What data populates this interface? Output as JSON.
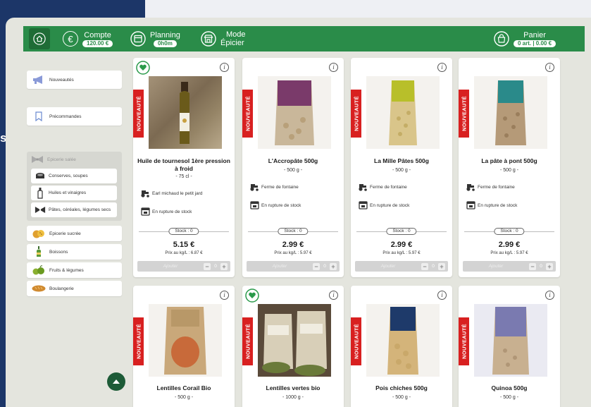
{
  "background_letter": "s",
  "topbar": {
    "compte_label": "Compte",
    "compte_value": "120.00 €",
    "planning_label": "Planning",
    "planning_value": "0h0m",
    "mode_line1": "Mode",
    "mode_line2": "Épicier",
    "panier_label": "Panier",
    "panier_value": "0 art. | 0.00 €"
  },
  "sidebar": {
    "nouveautes": "Nouveautés",
    "precommandes": "Précommandes",
    "epicerie_salee": "Epicerie salée",
    "subitems": [
      "Conserves, soupes",
      "Huiles et vinaigres",
      "Pâtes, céréales, légumes secs"
    ],
    "categories": [
      "Epicerie sucrée",
      "Boissons",
      "Fruits & légumes",
      "Boulangerie"
    ]
  },
  "common": {
    "badge": "NOUVEAUTÉ",
    "rupture": "En rupture de stock",
    "add_label": "Ajouter",
    "qty": "0",
    "info": "i"
  },
  "products": [
    {
      "name": "Huile de tournesol 1ère pression à froid",
      "qty": "- 75 cl -",
      "producer": "Earl michaud le petit jard",
      "stock": "Stock : 0",
      "price": "5.15 €",
      "price_per_kg": "Prix au kg/L : 6.87 €",
      "bio": true,
      "img_color": "#8a7a62"
    },
    {
      "name": "L'Accropâte 500g",
      "qty": "- 500 g -",
      "producer": "Ferme de fontaine",
      "stock": "Stock : 0",
      "price": "2.99 €",
      "price_per_kg": "Prix au kg/L : 5.97 €",
      "bio": false,
      "img_color": "#7a3a6a"
    },
    {
      "name": "La Mille Pâtes 500g",
      "qty": "- 500 g -",
      "producer": "Ferme de fontaine",
      "stock": "Stock : 0",
      "price": "2.99 €",
      "price_per_kg": "Prix au kg/L : 5.97 €",
      "bio": false,
      "img_color": "#b8bf2a"
    },
    {
      "name": "La pâte à pont 500g",
      "qty": "- 500 g -",
      "producer": "Ferme de fontaine",
      "stock": "Stock : 0",
      "price": "2.99 €",
      "price_per_kg": "Prix au kg/L : 5.97 €",
      "bio": false,
      "img_color": "#2a8a8a"
    },
    {
      "name": "Lentilles Corail Bio",
      "qty": "- 500 g -",
      "bio": false,
      "img_color": "#c06a3a"
    },
    {
      "name": "Lentilles vertes bio",
      "qty": "- 1000 g -",
      "bio": true,
      "img_color": "#5a4a3a"
    },
    {
      "name": "Pois chiches 500g",
      "qty": "- 500 g -",
      "bio": false,
      "img_color": "#c9a86a"
    },
    {
      "name": "Quinoa 500g",
      "qty": "- 500 g -",
      "bio": false,
      "img_color": "#7a7ab0"
    }
  ]
}
